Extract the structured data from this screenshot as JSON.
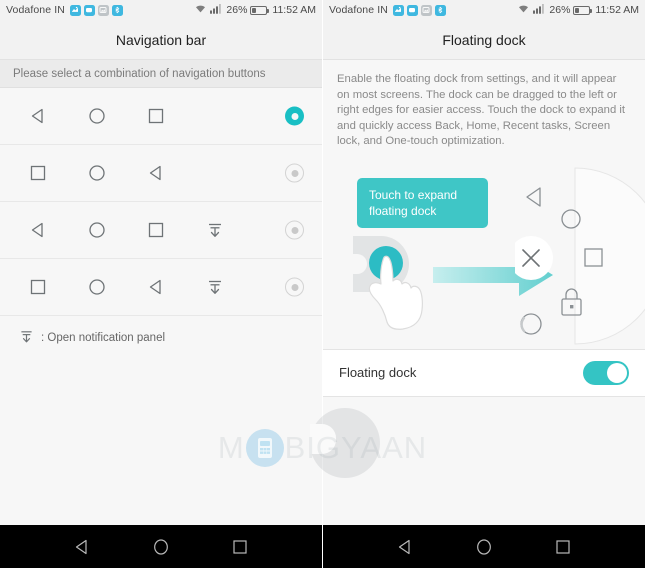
{
  "statusbar": {
    "carrier": "Vodafone IN",
    "battery_percent": "26%",
    "clock": "11:52 AM",
    "icons": [
      "sync-badge-icon",
      "message-badge-icon",
      "image-badge-icon",
      "bluetooth-badge-icon"
    ]
  },
  "left_screen": {
    "title": "Navigation bar",
    "hint": "Please select a combination of navigation buttons",
    "rows": [
      {
        "keys": [
          "back",
          "home",
          "recents"
        ],
        "selected": true
      },
      {
        "keys": [
          "recents",
          "home",
          "back"
        ],
        "selected": false
      },
      {
        "keys": [
          "back",
          "home",
          "recents",
          "notifications"
        ],
        "selected": false
      },
      {
        "keys": [
          "recents",
          "home",
          "back",
          "notifications"
        ],
        "selected": false
      }
    ],
    "legend": ": Open notification panel"
  },
  "right_screen": {
    "title": "Floating dock",
    "description": "Enable the floating dock from settings, and it will appear on most screens. The dock can be dragged to the left or right edges for easier access. Touch the dock to expand it and quickly access Back, Home, Recent tasks, Screen lock, and One-touch optimization.",
    "tooltip": "Touch to expand floating dock",
    "dock_items": [
      "back",
      "home",
      "close",
      "recents",
      "screen-lock",
      "optimize"
    ],
    "toggle": {
      "label": "Floating dock",
      "state": "on"
    }
  },
  "navbar": {
    "buttons": [
      "back",
      "home",
      "recents"
    ]
  },
  "watermark": {
    "text_left": "M",
    "text_right": "BIGYAAN"
  },
  "colors": {
    "accent_teal": "#19bfc4",
    "tooltip_teal": "#3fc6c6",
    "switch_teal": "#34c4c4",
    "status_badge_blue": "#3fb8e0"
  }
}
